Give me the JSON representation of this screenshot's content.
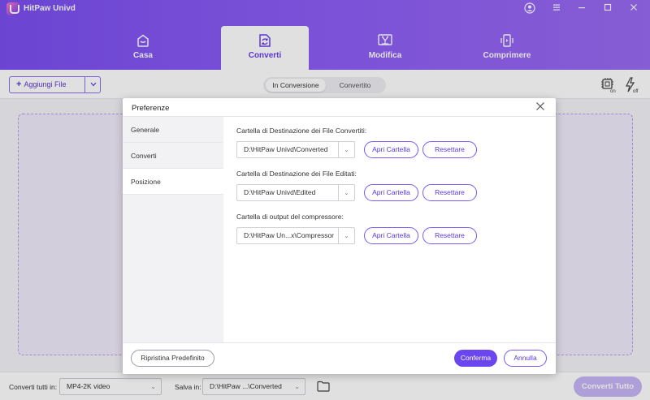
{
  "app": {
    "title": "HitPaw Univd"
  },
  "window_controls": [
    "account-icon",
    "menu-icon",
    "minimize-icon",
    "maximize-icon",
    "close-icon"
  ],
  "main_tabs": [
    {
      "label": "Casa",
      "icon": "home-icon"
    },
    {
      "label": "Converti",
      "icon": "convert-icon",
      "active": true
    },
    {
      "label": "Modifica",
      "icon": "edit-icon"
    },
    {
      "label": "Comprimere",
      "icon": "compress-icon"
    }
  ],
  "toolbar": {
    "add_files_label": "Aggiungi File",
    "segment": [
      "In Conversione",
      "Convertito"
    ],
    "hw_accel_label": "on",
    "speed_label": "off"
  },
  "dialog": {
    "title": "Preferenze",
    "sidebar": [
      "Generale",
      "Converti",
      "Posizione"
    ],
    "active_sidebar": "Posizione",
    "fields": [
      {
        "label": "Cartella di Destinazione dei File Convertiti:",
        "value": "D:\\HitPaw Univd\\Converted"
      },
      {
        "label": "Cartella di Destinazione dei File Editati:",
        "value": "D:\\HitPaw Univd\\Edited"
      },
      {
        "label": "Cartella di output del compressore:",
        "value": "D:\\HitPaw Un...x\\Compressor"
      }
    ],
    "open_folder_label": "Apri Cartella",
    "reset_label": "Resettare",
    "restore_defaults_label": "Ripristina Predefinito",
    "confirm_label": "Conferma",
    "cancel_label": "Annulla"
  },
  "bottom": {
    "convert_all_to_label": "Converti tutti in:",
    "format_value": "MP4-2K video",
    "save_in_label": "Salva in:",
    "save_path": "D:\\HitPaw ...\\Converted",
    "convert_all_button": "Converti Tutto"
  },
  "colors": {
    "accent": "#6b45ee",
    "header_start": "#7a4ff0",
    "header_end": "#9a6af2"
  }
}
